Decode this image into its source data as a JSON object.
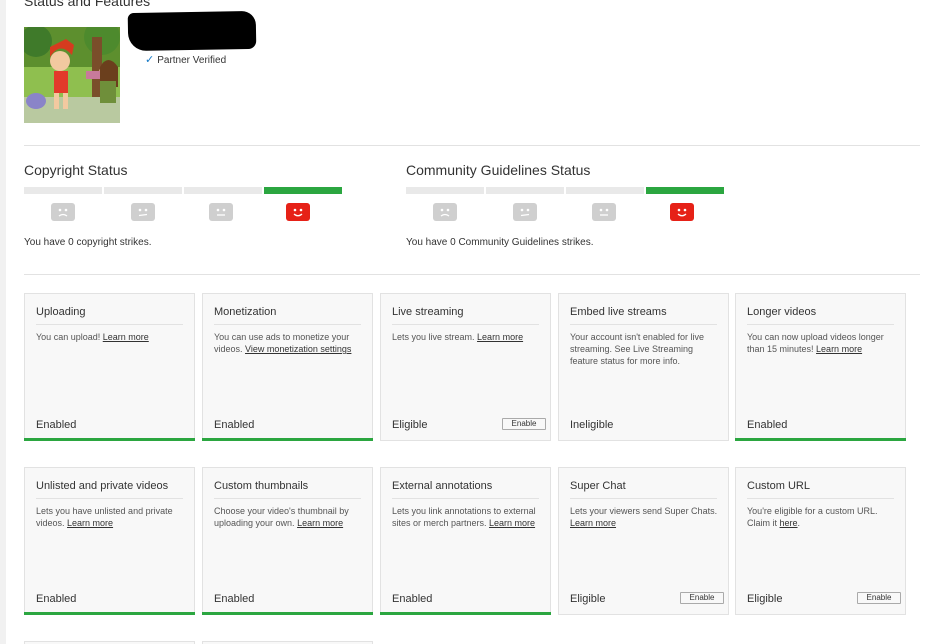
{
  "page": {
    "title": "Status and Features"
  },
  "account": {
    "partner_text": "Partner Verified"
  },
  "copyright": {
    "title": "Copyright Status",
    "strikes_text": "You have 0 copyright strikes.",
    "level": 4
  },
  "community": {
    "title": "Community Guidelines Status",
    "strikes_text": "You have 0 Community Guidelines strikes.",
    "level": 4
  },
  "colors": {
    "green": "#2ba640",
    "red": "#e62117",
    "grey": "#cfcfcf",
    "link_blue": "#167ac6"
  },
  "cards": [
    {
      "title": "Uploading",
      "desc_pre": "You can upload! ",
      "link": "Learn more",
      "desc_post": "",
      "state": "Enabled",
      "bar": true,
      "button": ""
    },
    {
      "title": "Monetization",
      "desc_pre": "You can use ads to monetize your videos. ",
      "link": "View monetization settings",
      "desc_post": "",
      "state": "Enabled",
      "bar": true,
      "button": ""
    },
    {
      "title": "Live streaming",
      "desc_pre": "Lets you live stream. ",
      "link": "Learn more",
      "desc_post": "",
      "state": "Eligible",
      "bar": false,
      "button": "Enable"
    },
    {
      "title": "Embed live streams",
      "desc_pre": "Your account isn't enabled for live streaming. See Live Streaming feature status for more info.",
      "link": "",
      "desc_post": "",
      "state": "Ineligible",
      "bar": false,
      "button": ""
    },
    {
      "title": "Longer videos",
      "desc_pre": "You can now upload videos longer than 15 minutes! ",
      "link": "Learn more",
      "desc_post": "",
      "state": "Enabled",
      "bar": true,
      "button": ""
    },
    {
      "title": "Unlisted and private videos",
      "desc_pre": "Lets you have unlisted and private videos. ",
      "link": "Learn more",
      "desc_post": "",
      "state": "Enabled",
      "bar": true,
      "button": ""
    },
    {
      "title": "Custom thumbnails",
      "desc_pre": "Choose your video's thumbnail by uploading your own. ",
      "link": "Learn more",
      "desc_post": "",
      "state": "Enabled",
      "bar": true,
      "button": ""
    },
    {
      "title": "External annotations",
      "desc_pre": "Lets you link annotations to external sites or merch partners. ",
      "link": "Learn more",
      "desc_post": "",
      "state": "Enabled",
      "bar": true,
      "button": ""
    },
    {
      "title": "Super Chat",
      "desc_pre": "Lets your viewers send Super Chats. ",
      "link": "Learn more",
      "desc_post": "",
      "state": "Eligible",
      "bar": false,
      "button": "Enable"
    },
    {
      "title": "Custom URL",
      "desc_pre": "You're eligible for a custom URL. Claim it ",
      "link": "here",
      "desc_post": ".",
      "state": "Eligible",
      "bar": false,
      "button": "Enable"
    }
  ]
}
